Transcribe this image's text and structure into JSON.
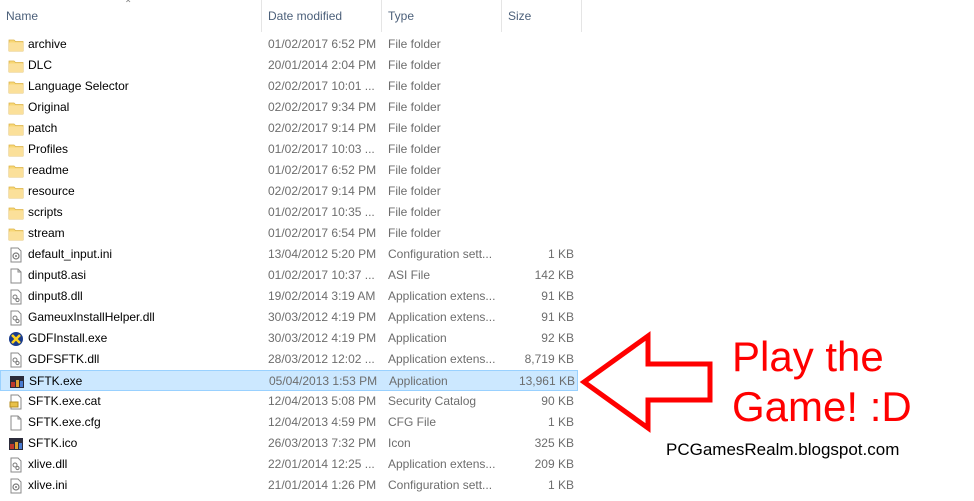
{
  "columns": {
    "name": "Name",
    "date": "Date modified",
    "type": "Type",
    "size": "Size"
  },
  "files": [
    {
      "name": "archive",
      "date": "01/02/2017 6:52 PM",
      "type": "File folder",
      "size": "",
      "icon": "folder-icon"
    },
    {
      "name": "DLC",
      "date": "20/01/2014 2:04 PM",
      "type": "File folder",
      "size": "",
      "icon": "folder-icon"
    },
    {
      "name": "Language Selector",
      "date": "02/02/2017 10:01 ...",
      "type": "File folder",
      "size": "",
      "icon": "folder-icon"
    },
    {
      "name": "Original",
      "date": "02/02/2017 9:34 PM",
      "type": "File folder",
      "size": "",
      "icon": "folder-icon"
    },
    {
      "name": "patch",
      "date": "02/02/2017 9:14 PM",
      "type": "File folder",
      "size": "",
      "icon": "folder-icon"
    },
    {
      "name": "Profiles",
      "date": "01/02/2017 10:03 ...",
      "type": "File folder",
      "size": "",
      "icon": "folder-icon"
    },
    {
      "name": "readme",
      "date": "01/02/2017 6:52 PM",
      "type": "File folder",
      "size": "",
      "icon": "folder-icon"
    },
    {
      "name": "resource",
      "date": "02/02/2017 9:14 PM",
      "type": "File folder",
      "size": "",
      "icon": "folder-icon"
    },
    {
      "name": "scripts",
      "date": "01/02/2017 10:35 ...",
      "type": "File folder",
      "size": "",
      "icon": "folder-icon"
    },
    {
      "name": "stream",
      "date": "01/02/2017 6:54 PM",
      "type": "File folder",
      "size": "",
      "icon": "folder-icon"
    },
    {
      "name": "default_input.ini",
      "date": "13/04/2012 5:20 PM",
      "type": "Configuration sett...",
      "size": "1 KB",
      "icon": "config-file-icon"
    },
    {
      "name": "dinput8.asi",
      "date": "01/02/2017 10:37 ...",
      "type": "ASI File",
      "size": "142 KB",
      "icon": "blank-file-icon"
    },
    {
      "name": "dinput8.dll",
      "date": "19/02/2014 3:19 AM",
      "type": "Application extens...",
      "size": "91 KB",
      "icon": "dll-file-icon"
    },
    {
      "name": "GameuxInstallHelper.dll",
      "date": "30/03/2012 4:19 PM",
      "type": "Application extens...",
      "size": "91 KB",
      "icon": "dll-file-icon"
    },
    {
      "name": "GDFInstall.exe",
      "date": "30/03/2012 4:19 PM",
      "type": "Application",
      "size": "92 KB",
      "icon": "installer-app-icon"
    },
    {
      "name": "GDFSFTK.dll",
      "date": "28/03/2012 12:02 ...",
      "type": "Application extens...",
      "size": "8,719 KB",
      "icon": "dll-file-icon"
    },
    {
      "name": "SFTK.exe",
      "date": "05/04/2013 1:53 PM",
      "type": "Application",
      "size": "13,961 KB",
      "icon": "game-app-icon",
      "selected": true
    },
    {
      "name": "SFTK.exe.cat",
      "date": "12/04/2013 5:08 PM",
      "type": "Security Catalog",
      "size": "90 KB",
      "icon": "catalog-file-icon"
    },
    {
      "name": "SFTK.exe.cfg",
      "date": "12/04/2013 4:59 PM",
      "type": "CFG File",
      "size": "1 KB",
      "icon": "blank-file-icon"
    },
    {
      "name": "SFTK.ico",
      "date": "26/03/2013 7:32 PM",
      "type": "Icon",
      "size": "325 KB",
      "icon": "game-app-icon"
    },
    {
      "name": "xlive.dll",
      "date": "22/01/2014 12:25 ...",
      "type": "Application extens...",
      "size": "209 KB",
      "icon": "dll-file-icon"
    },
    {
      "name": "xlive.ini",
      "date": "21/01/2014 1:26 PM",
      "type": "Configuration sett...",
      "size": "1 KB",
      "icon": "config-file-icon"
    }
  ],
  "annotation": {
    "line1": "Play the",
    "line2": "Game! :D",
    "color": "#ff0000"
  },
  "watermark": "PCGamesRealm.blogspot.com",
  "colors": {
    "selected_bg": "#cce8ff",
    "selected_border": "#99d1ff",
    "folder": "#f8d775",
    "header_text": "#4c607a"
  }
}
